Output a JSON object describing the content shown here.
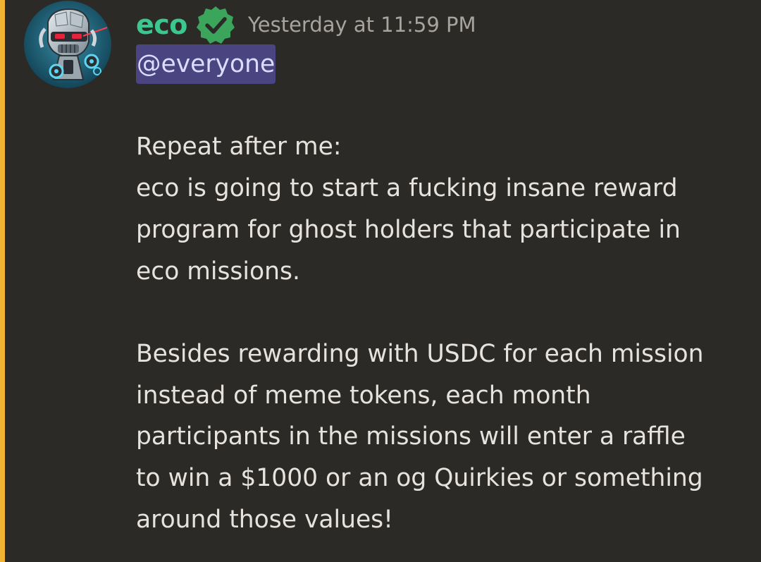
{
  "message": {
    "author": {
      "username": "eco",
      "verified_icon": "verified-check-badge-icon",
      "avatar_icon": "robot-skull-avatar"
    },
    "timestamp": "Yesterday at 11:59 PM",
    "mention": "@everyone",
    "lines": [
      "Repeat after me:",
      "eco is going to start a fucking insane reward",
      "program for ghost holders that participate in",
      "eco missions.",
      "Besides rewarding with USDC for each mission",
      "instead of meme tokens, each month",
      "participants in the missions will enter a raffle",
      "to win a $1000 or an og Quirkies or something",
      "around those values!"
    ]
  },
  "colors": {
    "background": "#2c2a27",
    "highlight_bar": "#f0b232",
    "username": "#3bc78e",
    "verified_badge": "#3ba55c",
    "timestamp": "#a7a39e",
    "text": "#e6e3df",
    "mention_bg": "#4a4580",
    "mention_text": "#dcdcff"
  }
}
